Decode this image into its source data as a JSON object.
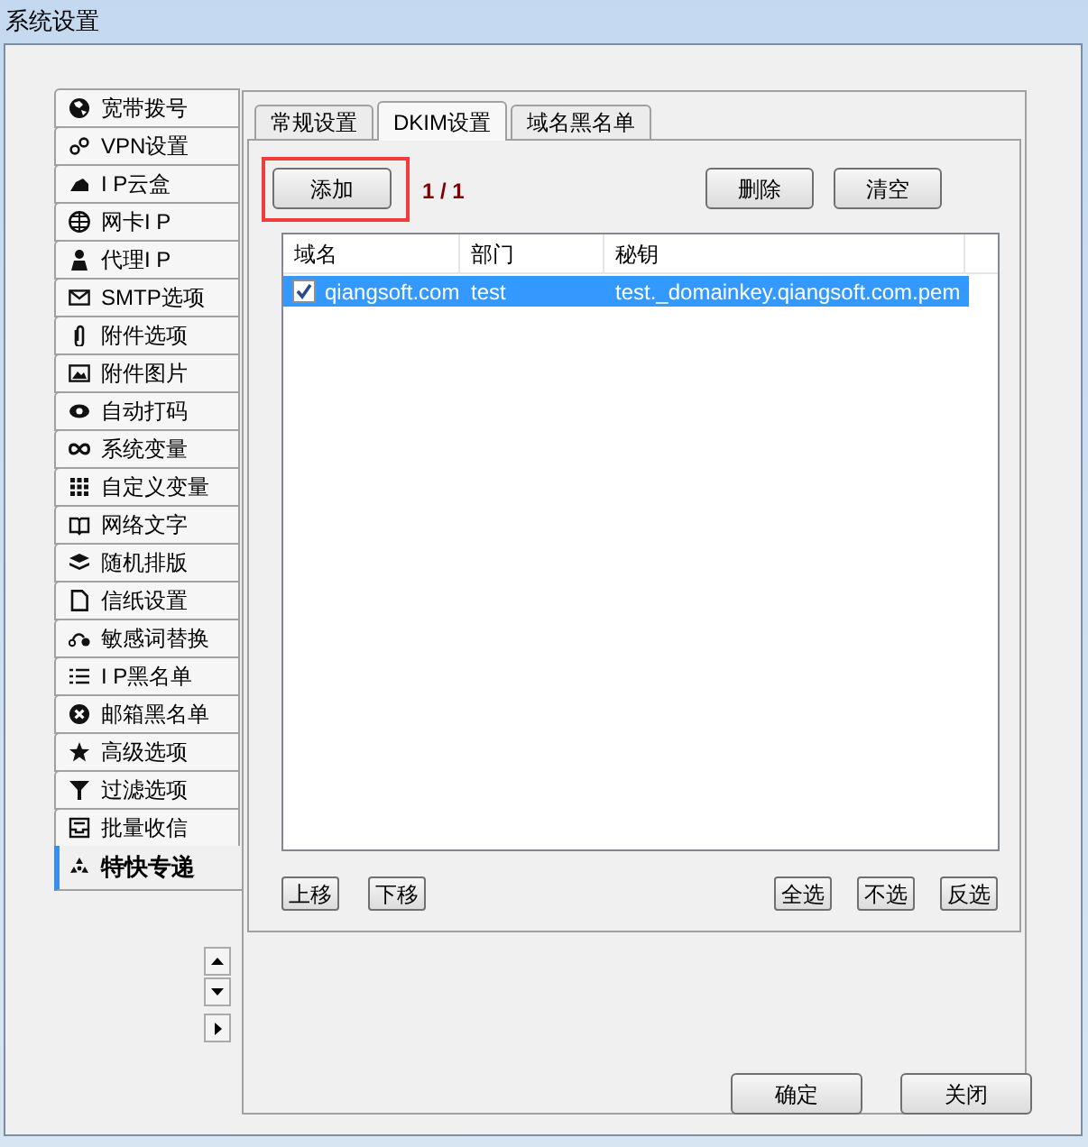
{
  "window": {
    "title": "系统设置"
  },
  "sidebar": {
    "items": [
      {
        "label": "宽带拨号",
        "selected": false
      },
      {
        "label": "VPN设置",
        "selected": false
      },
      {
        "label": "I P云盒",
        "selected": false
      },
      {
        "label": "网卡I P",
        "selected": false
      },
      {
        "label": "代理I P",
        "selected": false
      },
      {
        "label": "SMTP选项",
        "selected": false
      },
      {
        "label": "附件选项",
        "selected": false
      },
      {
        "label": "附件图片",
        "selected": false
      },
      {
        "label": "自动打码",
        "selected": false
      },
      {
        "label": "系统变量",
        "selected": false
      },
      {
        "label": "自定义变量",
        "selected": false
      },
      {
        "label": "网络文字",
        "selected": false
      },
      {
        "label": "随机排版",
        "selected": false
      },
      {
        "label": "信纸设置",
        "selected": false
      },
      {
        "label": "敏感词替换",
        "selected": false
      },
      {
        "label": "I P黑名单",
        "selected": false
      },
      {
        "label": "邮箱黑名单",
        "selected": false
      },
      {
        "label": "高级选项",
        "selected": false
      },
      {
        "label": "过滤选项",
        "selected": false
      },
      {
        "label": "批量收信",
        "selected": false
      },
      {
        "label": "特快专递",
        "selected": true
      }
    ]
  },
  "tabs": [
    {
      "label": "常规设置",
      "selected": false
    },
    {
      "label": "DKIM设置",
      "selected": true
    },
    {
      "label": "域名黑名单",
      "selected": false
    }
  ],
  "toolbar": {
    "add": "添加",
    "page": "1 / 1",
    "delete": "删除",
    "clear": "清空"
  },
  "table": {
    "columns": [
      "域名",
      "部门",
      "秘钥"
    ],
    "rows": [
      {
        "checked": true,
        "selected": true,
        "cells": [
          "qiangsoft.com",
          "test",
          "test._domainkey.qiangsoft.com.pem"
        ]
      }
    ]
  },
  "list_buttons": {
    "left": [
      "上移",
      "下移"
    ],
    "right": [
      "全选",
      "不选",
      "反选"
    ]
  },
  "buttons": [
    "确定",
    "关闭"
  ]
}
